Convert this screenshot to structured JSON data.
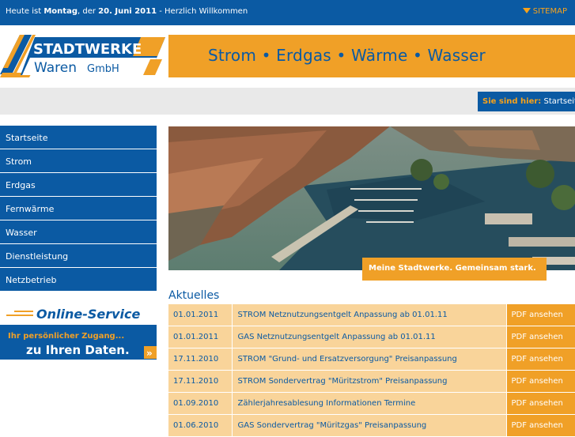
{
  "topbar": {
    "date_prefix": "Heute ist",
    "weekday": "Montag",
    "date_mid": ", der",
    "date": "20. Juni 2011",
    "greeting": "- Herzlich Willkommen",
    "sitemap": "SITEMAP"
  },
  "logo": {
    "line1": "STADTWERKE",
    "line2": "Waren",
    "line3": "GmbH"
  },
  "banner": {
    "slogan": "Strom • Erdgas • Wärme • Wasser"
  },
  "breadcrumb": {
    "label": "Sie sind hier:",
    "current": "Startseite"
  },
  "nav": {
    "items": [
      {
        "label": "Startseite"
      },
      {
        "label": "Strom"
      },
      {
        "label": "Erdgas"
      },
      {
        "label": "Fernwärme"
      },
      {
        "label": "Wasser"
      },
      {
        "label": "Dienstleistung"
      },
      {
        "label": "Netzbetrieb"
      }
    ]
  },
  "online_service": {
    "title": "Online-Service",
    "line1": "Ihr persönlicher Zugang...",
    "line2": "zu Ihren Daten.",
    "arrow": "»"
  },
  "hero": {
    "claim": "Meine Stadtwerke. Gemeinsam stark."
  },
  "news": {
    "heading": "Aktuelles",
    "rows": [
      {
        "date": "01.01.2011",
        "title": "STROM Netznutzungsentgelt Anpassung ab 01.01.11",
        "pdf": "PDF ansehen"
      },
      {
        "date": "01.01.2011",
        "title": "GAS Netznutzungsentgelt Anpassung ab 01.01.11",
        "pdf": "PDF ansehen"
      },
      {
        "date": "17.11.2010",
        "title": "STROM \"Grund- und Ersatzversorgung\" Preisanpassung",
        "pdf": "PDF ansehen"
      },
      {
        "date": "17.11.2010",
        "title": "STROM Sondervertrag \"Müritzstrom\" Preisanpassung",
        "pdf": "PDF ansehen"
      },
      {
        "date": "01.09.2010",
        "title": "Zählerjahresablesung Informationen Termine",
        "pdf": "PDF ansehen"
      },
      {
        "date": "01.06.2010",
        "title": "GAS Sondervertrag \"Müritzgas\" Preisanpassung",
        "pdf": "PDF ansehen"
      }
    ]
  },
  "colors": {
    "brand_blue": "#0b5aa3",
    "brand_orange": "#f0a027",
    "row_bg": "#f9d49a"
  }
}
